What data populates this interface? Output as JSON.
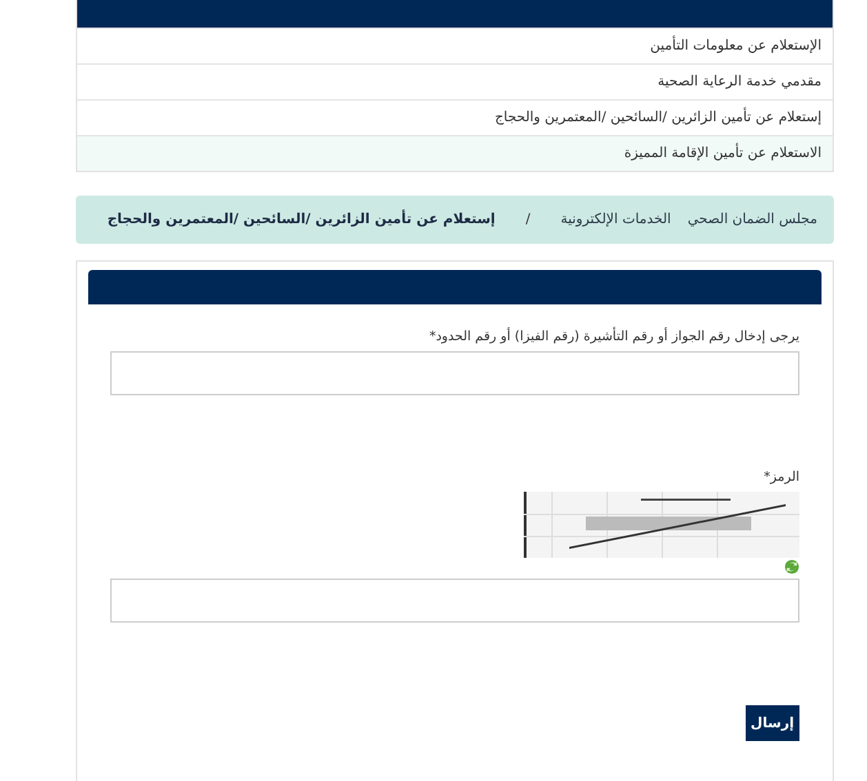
{
  "menu": {
    "items": [
      {
        "label": "الإستعلام عن معلومات التأمين",
        "selected": false
      },
      {
        "label": "مقدمي خدمة الرعاية الصحية",
        "selected": false
      },
      {
        "label": "إستعلام عن تأمين الزائرين /السائحين /المعتمرين والحجاج",
        "selected": false
      },
      {
        "label": "الاستعلام عن تأمين الإقامة المميزة",
        "selected": true
      }
    ]
  },
  "breadcrumb": {
    "items": [
      {
        "label": "مجلس الضمان الصحي",
        "current": false
      },
      {
        "label": "الخدمات الإلكترونية",
        "current": false
      },
      {
        "label": "إستعلام عن تأمين الزائرين /السائحين /المعتمرين والحجاج",
        "current": true
      }
    ],
    "separator": "/"
  },
  "form": {
    "document_label": "يرجى إدخال رقم الجواز أو رقم التأشيرة (رقم الفيزا) أو رقم الحدود*",
    "code_label": "الرمز*",
    "submit": "إرسال"
  }
}
